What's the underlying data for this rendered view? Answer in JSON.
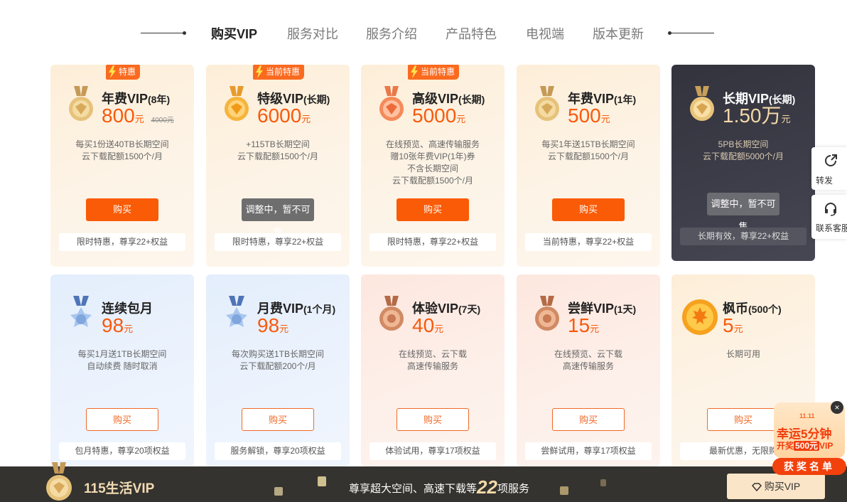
{
  "nav": {
    "tabs": [
      "购买VIP",
      "服务对比",
      "服务介绍",
      "产品特色",
      "电视端",
      "版本更新"
    ]
  },
  "cards": [
    {
      "badge": "特惠",
      "title": "年费VIP",
      "title_sub": "(8年)",
      "price": "800",
      "unit": "元",
      "old_price": "4000元",
      "desc": [
        "每买1份送40TB长期空间",
        "云下载配额1500个/月"
      ],
      "button": "购买",
      "benefit": "限时特惠，尊享22+权益"
    },
    {
      "badge": "当前特惠",
      "title": "特级VIP",
      "title_sub": "(长期)",
      "price": "6000",
      "unit": "元",
      "desc": [
        "+115TB长期空间",
        "云下载配额1500个/月"
      ],
      "button": "调整中，暂不可售",
      "benefit": "限时特惠，尊享22+权益"
    },
    {
      "badge": "当前特惠",
      "title": "高级VIP",
      "title_sub": "(长期)",
      "price": "5000",
      "unit": "元",
      "desc": [
        "在线预览、高速传输服务",
        "赠10张年费VIP(1年)券",
        "不含长期空间",
        "云下载配额1500个/月"
      ],
      "button": "购买",
      "benefit": "限时特惠，尊享22+权益"
    },
    {
      "title": "年费VIP",
      "title_sub": "(1年)",
      "price": "500",
      "unit": "元",
      "desc": [
        "每买1年送15TB长期空间",
        "云下载配额1500个/月"
      ],
      "button": "购买",
      "benefit": "当前特惠，尊享22+权益"
    },
    {
      "title": "长期VIP",
      "title_sub": "(长期)",
      "price": "1.50万",
      "unit": "元",
      "desc": [
        "5PB长期空间",
        "云下载配额5000个/月"
      ],
      "button": "调整中，暂不可售",
      "benefit": "长期有效，尊享22+权益"
    },
    {
      "title": "连续包月",
      "title_sub": "",
      "price": "98",
      "unit": "元",
      "desc": [
        "每买1月送1TB长期空间",
        "自动续费 随时取消"
      ],
      "button": "购买",
      "benefit": "包月特惠，尊享20项权益"
    },
    {
      "title": "月费VIP",
      "title_sub": "(1个月)",
      "price": "98",
      "unit": "元",
      "desc": [
        "每次购买送1TB长期空间",
        "云下载配额200个/月"
      ],
      "button": "购买",
      "benefit": "服务解锁，尊享20项权益"
    },
    {
      "title": "体验VIP",
      "title_sub": "(7天)",
      "price": "40",
      "unit": "元",
      "desc": [
        "在线预览、云下载",
        "高速传输服务"
      ],
      "button": "购买",
      "benefit": "体验试用，尊享17项权益"
    },
    {
      "title": "尝鲜VIP",
      "title_sub": "(1天)",
      "price": "15",
      "unit": "元",
      "desc": [
        "在线预览、云下载",
        "高速传输服务"
      ],
      "button": "购买",
      "benefit": "尝鲜试用，尊享17项权益"
    },
    {
      "title": "枫币",
      "title_sub": "(500个)",
      "price": "5",
      "unit": "元",
      "desc": [
        "长期可用"
      ],
      "button": "购买",
      "benefit": "最新优惠，无限购"
    }
  ],
  "float": {
    "share": "转发",
    "service": "联系客服"
  },
  "promo": {
    "date": "11.11",
    "line1": "幸运5分钟",
    "line2_pre": "开奖",
    "line2_hl": "500元",
    "line2_post": "VIP",
    "list": "获奖名单",
    "close": "×"
  },
  "bottom": {
    "title": "115生活VIP",
    "slogan_pre": "尊享超大空间、高速下载等",
    "slogan_num": "22",
    "slogan_post": "项服务",
    "buy": "购买VIP"
  },
  "colors": {
    "accent": "#fa5b06",
    "dark_card": "#3a3a44",
    "bottom_bar": "#34332f"
  }
}
